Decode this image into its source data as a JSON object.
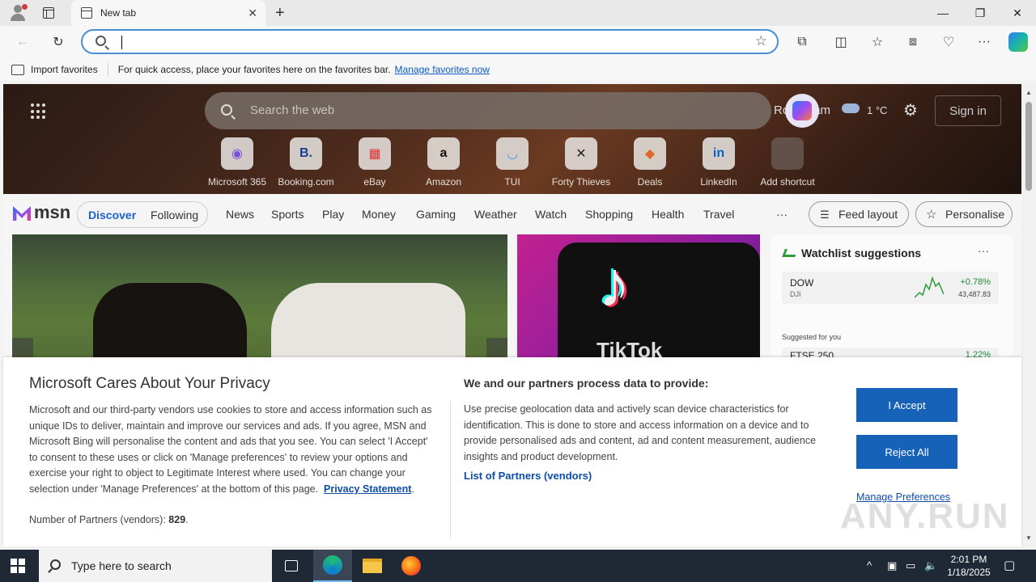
{
  "browser": {
    "tab_title": "New tab",
    "favorites_bar": {
      "import_label": "Import favorites",
      "hint": "For quick access, place your favorites here on the favorites bar.",
      "manage_link": "Manage favorites now"
    }
  },
  "hero": {
    "search_placeholder": "Search the web",
    "location": "Rotterdam",
    "temperature": "1",
    "temperature_unit": "°C",
    "sign_in": "Sign in",
    "shortcuts": [
      {
        "label": "Microsoft 365",
        "glyph": "◉",
        "color": "#7a4fd8"
      },
      {
        "label": "Booking.com",
        "glyph": "B.",
        "color": "#1a3d8f"
      },
      {
        "label": "eBay",
        "glyph": "▦",
        "color": "#e43137"
      },
      {
        "label": "Amazon",
        "glyph": "a",
        "color": "#111111"
      },
      {
        "label": "TUI",
        "glyph": "◡",
        "color": "#2fa3e0"
      },
      {
        "label": "Forty Thieves",
        "glyph": "✕",
        "color": "#222222"
      },
      {
        "label": "Deals",
        "glyph": "◆",
        "color": "#e0682a"
      },
      {
        "label": "LinkedIn",
        "glyph": "in",
        "color": "#0a66c2"
      },
      {
        "label": "Add shortcut",
        "glyph": "+",
        "color": "#555555"
      }
    ]
  },
  "msn": {
    "logo_text": "msn",
    "pill": {
      "discover": "Discover",
      "following": "Following"
    },
    "nav": [
      "News",
      "Sports",
      "Play",
      "Money",
      "Gaming",
      "Weather",
      "Watch",
      "Shopping",
      "Health",
      "Travel"
    ],
    "more": "···",
    "feed_layout": "Feed layout",
    "personalise": "Personalise"
  },
  "cards": {
    "tiktok_text": "TikTok",
    "watchlist": {
      "title": "Watchlist suggestions",
      "more": "···",
      "stock": {
        "name": "DOW",
        "sub": "DJI",
        "change": "+0.78%",
        "value": "43,487.83"
      },
      "suggested_label": "Suggested for you",
      "stock2": {
        "name": "FTSE 250",
        "change": "1.22%"
      }
    }
  },
  "consent": {
    "title": "Microsoft Cares About Your Privacy",
    "body": "Microsoft and our third-party vendors use cookies to store and access information such as unique IDs to deliver, maintain and improve our services and ads. If you agree, MSN and Microsoft Bing will personalise the content and ads that you see. You can select 'I Accept' to consent to these uses or click on 'Manage preferences' to review your options and exercise your right to object to Legitimate Interest where used.  You can change your selection under 'Manage Preferences' at the bottom of this page.",
    "privacy_link": "Privacy Statement",
    "partners_label": "Number of Partners (vendors):",
    "partners_count": "829",
    "title2": "We and our partners process data to provide:",
    "body2": "Use precise geolocation data and actively scan device characteristics for identification. This is done to store and access information on a device and to provide personalised ads and content, ad and content measurement, audience insights and product development.",
    "list_link": "List of Partners (vendors)",
    "accept": "I Accept",
    "reject": "Reject All",
    "manage": "Manage Preferences",
    "watermark": "ANY.RUN"
  },
  "taskbar": {
    "search_text": "Type here to search",
    "time": "2:01 PM",
    "date": "1/18/2025"
  }
}
